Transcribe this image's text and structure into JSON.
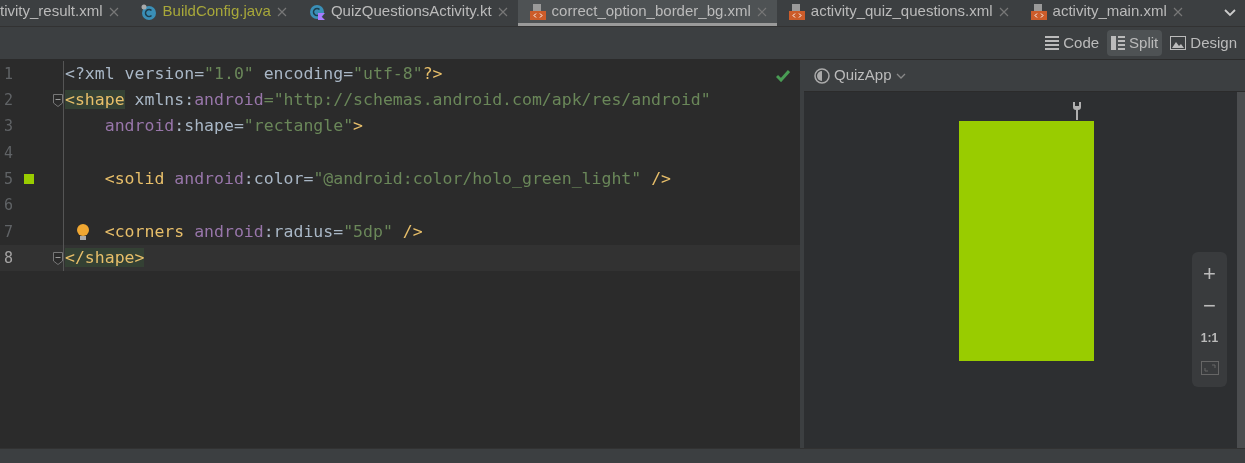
{
  "tabs": [
    {
      "label": "tivity_result.xml",
      "kind": "plain",
      "color": "#bbbbbb",
      "selected": false
    },
    {
      "label": "BuildConfig.java",
      "kind": "java",
      "color": "#a8a83a",
      "selected": false
    },
    {
      "label": "QuizQuestionsActivity.kt",
      "kind": "kotlin",
      "color": "#bbbbbb",
      "selected": false
    },
    {
      "label": "correct_option_border_bg.xml",
      "kind": "xml",
      "color": "#bbbbbb",
      "selected": true
    },
    {
      "label": "activity_quiz_questions.xml",
      "kind": "xml",
      "color": "#bbbbbb",
      "selected": false
    },
    {
      "label": "activity_main.xml",
      "kind": "xml",
      "color": "#bbbbbb",
      "selected": false
    }
  ],
  "view_modes": [
    {
      "label": "Code",
      "kind": "code",
      "selected": false
    },
    {
      "label": "Split",
      "kind": "split",
      "selected": true
    },
    {
      "label": "Design",
      "kind": "design",
      "selected": false
    }
  ],
  "editor": {
    "lines": [
      {
        "number": "1",
        "current": false,
        "kind": "plain",
        "tokens": [
          {
            "kind": "plain",
            "text": "<?xml version="
          },
          {
            "kind": "str",
            "text": "\"1.0\""
          },
          {
            "kind": "plain",
            "text": " encoding="
          },
          {
            "kind": "str",
            "text": "\"utf-8\""
          },
          {
            "kind": "tag",
            "text": "?>"
          }
        ]
      },
      {
        "number": "2",
        "current": false,
        "kind": "fold",
        "tokens": [
          {
            "kind": "tag",
            "text": "<shape",
            "matched": true
          },
          {
            "kind": "plain",
            "text": " xmlns:"
          },
          {
            "kind": "ns",
            "text": "android"
          },
          {
            "kind": "str",
            "text": "=\"http://schemas.android.com/apk/res/android\""
          }
        ]
      },
      {
        "number": "3",
        "current": false,
        "kind": "plain",
        "tokens": [
          {
            "kind": "ns",
            "text": "    android"
          },
          {
            "kind": "plain",
            "text": ":shape="
          },
          {
            "kind": "str",
            "text": "\"rectangle\""
          },
          {
            "kind": "tag",
            "text": ">"
          }
        ]
      },
      {
        "number": "4",
        "current": false,
        "kind": "plain"
      },
      {
        "number": "5",
        "current": false,
        "kind": "swatch",
        "tokens": [
          {
            "kind": "tag",
            "text": "    <solid "
          },
          {
            "kind": "ns",
            "text": "android"
          },
          {
            "kind": "plain",
            "text": ":color="
          },
          {
            "kind": "str",
            "text": "\"@android:color/holo_green_light\""
          },
          {
            "kind": "tag",
            "text": " />"
          }
        ]
      },
      {
        "number": "6",
        "current": false,
        "kind": "plain"
      },
      {
        "number": "7",
        "current": false,
        "kind": "bulb",
        "tokens": [
          {
            "kind": "tag",
            "text": "    <corners "
          },
          {
            "kind": "ns",
            "text": "android"
          },
          {
            "kind": "plain",
            "text": ":radius="
          },
          {
            "kind": "str",
            "text": "\"5dp\""
          },
          {
            "kind": "tag",
            "text": " />"
          }
        ]
      },
      {
        "number": "8",
        "current": true,
        "kind": "fold",
        "tokens": [
          {
            "kind": "tag",
            "text": "</shape>",
            "matched": true
          }
        ]
      }
    ]
  },
  "preview": {
    "theme": "QuizApp",
    "zoom_controls": [
      "+",
      "−",
      "1:1"
    ]
  }
}
